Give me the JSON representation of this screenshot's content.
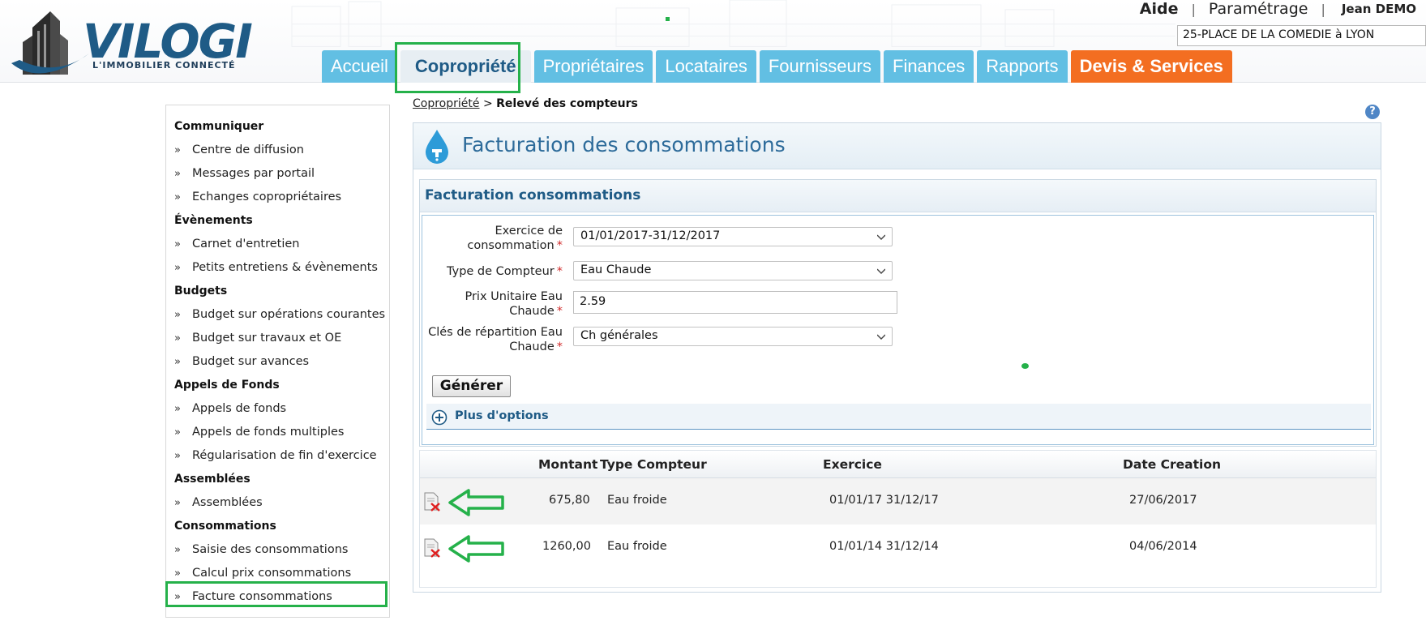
{
  "header": {
    "logo": {
      "name": "VILOGI",
      "tagline": "L'IMMOBILIER CONNECTÉ"
    },
    "top_links": {
      "help": "Aide",
      "settings": "Paramétrage",
      "user": "Jean DEMO"
    },
    "address_select": "25-PLACE DE LA COMEDIE à LYON",
    "tabs": [
      {
        "label": "Accueil"
      },
      {
        "label": "Copropriété"
      },
      {
        "label": "Propriétaires"
      },
      {
        "label": "Locataires"
      },
      {
        "label": "Fournisseurs"
      },
      {
        "label": "Finances"
      },
      {
        "label": "Rapports"
      },
      {
        "label": "Devis & Services"
      }
    ],
    "colors": {
      "tab": "#62bfe3",
      "tab_active": "#e7eef3",
      "tab_orange": "#f36e21",
      "highlight": "#25b14a"
    }
  },
  "sidebar": {
    "sections": [
      {
        "title": "Communiquer",
        "items": [
          "Centre de diffusion",
          "Messages par portail",
          "Echanges copropriétaires"
        ]
      },
      {
        "title": "Évènements",
        "items": [
          "Carnet d'entretien",
          "Petits entretiens & évènements"
        ]
      },
      {
        "title": "Budgets",
        "items": [
          "Budget sur opérations courantes",
          "Budget sur travaux et OE",
          "Budget sur avances"
        ]
      },
      {
        "title": "Appels de Fonds",
        "items": [
          "Appels de fonds",
          "Appels de fonds multiples",
          "Régularisation de fin d'exercice"
        ]
      },
      {
        "title": "Assemblées",
        "items": [
          "Assemblées"
        ]
      },
      {
        "title": "Consommations",
        "items": [
          "Saisie des consommations",
          "Calcul prix consommations",
          "Facture consommations"
        ]
      }
    ],
    "bullet": "»"
  },
  "breadcrumb": {
    "parent": "Copropriété",
    "separator": ">",
    "current": "Relevé des compteurs"
  },
  "help_icon": "?",
  "panel": {
    "title": "Facturation des consommations",
    "form": {
      "title": "Facturation consommations",
      "fields": {
        "exercice": {
          "label_1": "Exercice de",
          "label_2": "consommation",
          "value": "01/01/2017-31/12/2017"
        },
        "type": {
          "label": "Type de Compteur",
          "value": "Eau Chaude"
        },
        "prix": {
          "label_1": "Prix Unitaire Eau",
          "label_2": "Chaude",
          "value": "2.59"
        },
        "cles": {
          "label_1": "Clés de répartition Eau",
          "label_2": "Chaude",
          "value": "Ch générales"
        }
      },
      "required_mark": "*",
      "generate_button": "Générer",
      "more_options": "Plus d'options"
    },
    "table": {
      "headers": {
        "montant": "Montant",
        "type": "Type Compteur",
        "exercice": "Exercice",
        "date": "Date Creation"
      },
      "rows": [
        {
          "montant": "675,80",
          "type": "Eau froide",
          "exercice": "01/01/17 31/12/17",
          "date": "27/06/2017"
        },
        {
          "montant": "1260,00",
          "type": "Eau froide",
          "exercice": "01/01/14 31/12/14",
          "date": "04/06/2014"
        }
      ]
    }
  }
}
